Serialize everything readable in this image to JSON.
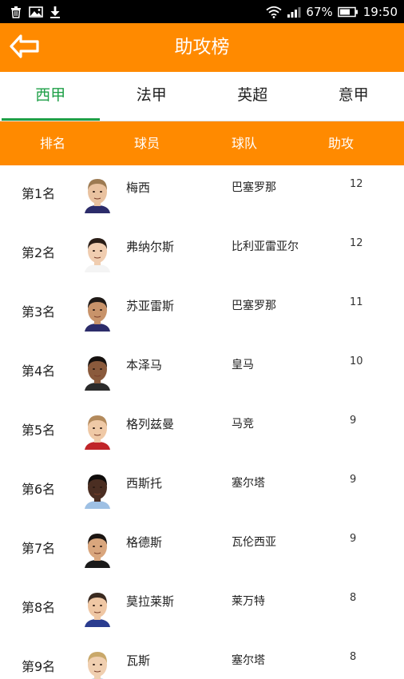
{
  "status_bar": {
    "left_icons": [
      "trash-icon",
      "image-icon",
      "download-icon"
    ],
    "battery_percent": "67%",
    "time": "19:50",
    "right_icons": [
      "wifi-icon",
      "signal-icon",
      "battery-icon"
    ]
  },
  "app_bar": {
    "title": "助攻榜",
    "back_icon": "back-arrow-icon"
  },
  "tabs": [
    {
      "label": "西甲",
      "active": true
    },
    {
      "label": "法甲",
      "active": false
    },
    {
      "label": "英超",
      "active": false
    },
    {
      "label": "意甲",
      "active": false
    }
  ],
  "table": {
    "headers": [
      "排名",
      "球员",
      "球队",
      "助攻"
    ],
    "rows": [
      {
        "rank": "第1名",
        "player": "梅西",
        "team": "巴塞罗那",
        "assists": "12"
      },
      {
        "rank": "第2名",
        "player": "弗纳尔斯",
        "team": "比利亚雷亚尔",
        "assists": "12"
      },
      {
        "rank": "第3名",
        "player": "苏亚雷斯",
        "team": "巴塞罗那",
        "assists": "11"
      },
      {
        "rank": "第4名",
        "player": "本泽马",
        "team": "皇马",
        "assists": "10"
      },
      {
        "rank": "第5名",
        "player": "格列兹曼",
        "team": "马竞",
        "assists": "9"
      },
      {
        "rank": "第6名",
        "player": "西斯托",
        "team": "塞尔塔",
        "assists": "9"
      },
      {
        "rank": "第7名",
        "player": "格德斯",
        "team": "瓦伦西亚",
        "assists": "9"
      },
      {
        "rank": "第8名",
        "player": "莫拉莱斯",
        "team": "莱万特",
        "assists": "8"
      },
      {
        "rank": "第9名",
        "player": "瓦斯",
        "team": "塞尔塔",
        "assists": "8"
      }
    ]
  },
  "colors": {
    "accent": "#ff8a00",
    "active_tab": "#1fa048",
    "status_bar": "#000000"
  },
  "avatar_skin": [
    "#e9c2a0",
    "#f0cdb0",
    "#c8936a",
    "#8a5a3c",
    "#efc9a6",
    "#4b2e22",
    "#d9a67d",
    "#efc7a4",
    "#f0cfb0"
  ],
  "avatar_hair": [
    "#9c7a52",
    "#2a1e17",
    "#1f1a17",
    "#15110f",
    "#b38a5c",
    "#0f0c0b",
    "#1b1512",
    "#3a2a20",
    "#c9a86a"
  ],
  "avatar_shirt": [
    "#2c2c6a",
    "#f4f4f4",
    "#2c2c6a",
    "#2b2b2b",
    "#c02428",
    "#9ec0e4",
    "#1a1a1a",
    "#2a3c8f",
    "#9ec0e4"
  ]
}
